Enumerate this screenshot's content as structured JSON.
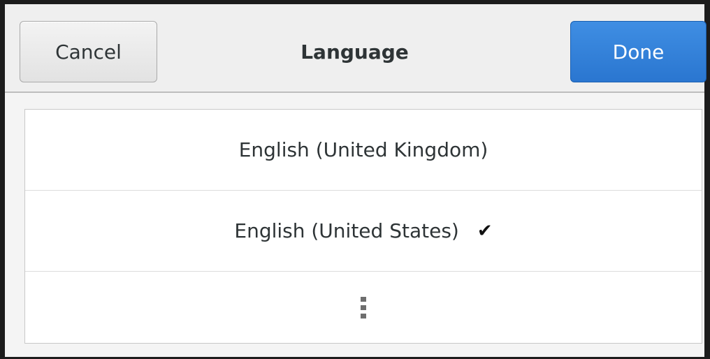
{
  "header": {
    "cancel_label": "Cancel",
    "title": "Language",
    "done_label": "Done"
  },
  "languages": [
    {
      "label": "English (United Kingdom)",
      "selected": false
    },
    {
      "label": "English (United States)",
      "selected": true
    }
  ],
  "check_symbol": "✔",
  "more_icon": "more-vertical-icon",
  "colors": {
    "done_bg": "#2a76d0",
    "frame": "#1c1c1c"
  }
}
